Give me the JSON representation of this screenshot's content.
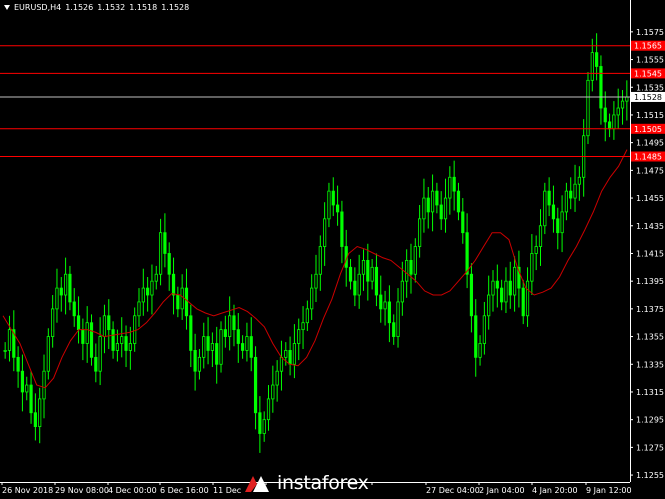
{
  "window": {
    "symbol": "EURUSD,H4",
    "ohlc": [
      "1.1526",
      "1.1532",
      "1.1518",
      "1.1528"
    ]
  },
  "watermark": {
    "text": "instaforex"
  },
  "colors": {
    "background": "#000000",
    "candle": "#00ff00",
    "moving_average": "#cc0000",
    "level_line": "#ff0000",
    "level_label_bg": "#ff0000",
    "current_price_line": "#c0c0c0",
    "axis_text": "#ffffff"
  },
  "chart_data": {
    "type": "candlestick",
    "ylim": [
      1.125,
      1.1585
    ],
    "y_ticks": [
      "1.1575",
      "1.1555",
      "1.1535",
      "1.1515",
      "1.1495",
      "1.1475",
      "1.1455",
      "1.1435",
      "1.1415",
      "1.1395",
      "1.1375",
      "1.1355",
      "1.1335",
      "1.1315",
      "1.1295",
      "1.1275",
      "1.1255"
    ],
    "x_tick_labels": [
      "26 Nov 2018",
      "29 Nov 08:00",
      "4 Dec 00:00",
      "6 Dec 16:00",
      "11 Dec",
      "",
      "",
      "",
      "27 Dec 04:00",
      "2 Jan 04:00",
      "4 Jan 20:00",
      "9 Jan 12:00"
    ],
    "level_lines": [
      {
        "value": 1.1565,
        "label": "1.1565"
      },
      {
        "value": 1.1545,
        "label": "1.1545"
      },
      {
        "value": 1.1505,
        "label": "1.1505"
      },
      {
        "value": 1.1485,
        "label": "1.1485"
      }
    ],
    "current_price": {
      "value": 1.1528,
      "label": "1.1528"
    },
    "close_path": [
      1.1345,
      1.136,
      1.134,
      1.133,
      1.1315,
      1.132,
      1.13,
      1.129,
      1.131,
      1.133,
      1.1355,
      1.1375,
      1.139,
      1.1385,
      1.14,
      1.138,
      1.137,
      1.136,
      1.135,
      1.1365,
      1.134,
      1.133,
      1.1355,
      1.137,
      1.136,
      1.1345,
      1.135,
      1.1355,
      1.1345,
      1.135,
      1.137,
      1.138,
      1.139,
      1.1385,
      1.1395,
      1.14,
      1.143,
      1.1415,
      1.14,
      1.1385,
      1.1375,
      1.139,
      1.137,
      1.1345,
      1.133,
      1.134,
      1.1355,
      1.1345,
      1.135,
      1.1335,
      1.136,
      1.1355,
      1.137,
      1.136,
      1.135,
      1.1345,
      1.1355,
      1.134,
      1.13,
      1.1285,
      1.1295,
      1.131,
      1.132,
      1.133,
      1.134,
      1.1345,
      1.1335,
      1.135,
      1.136,
      1.1365,
      1.1375,
      1.139,
      1.14,
      1.142,
      1.144,
      1.146,
      1.145,
      1.1445,
      1.142,
      1.1405,
      1.1395,
      1.1385,
      1.14,
      1.141,
      1.1395,
      1.1405,
      1.1385,
      1.1375,
      1.138,
      1.1365,
      1.1355,
      1.138,
      1.1395,
      1.141,
      1.14,
      1.142,
      1.144,
      1.1455,
      1.1445,
      1.146,
      1.145,
      1.144,
      1.1455,
      1.147,
      1.146,
      1.1445,
      1.143,
      1.14,
      1.137,
      1.134,
      1.135,
      1.137,
      1.1385,
      1.1395,
      1.139,
      1.138,
      1.1395,
      1.1385,
      1.1405,
      1.139,
      1.137,
      1.1395,
      1.1415,
      1.142,
      1.1435,
      1.146,
      1.145,
      1.144,
      1.143,
      1.1445,
      1.146,
      1.1455,
      1.1465,
      1.147,
      1.15,
      1.154,
      1.156,
      1.155,
      1.152,
      1.151,
      1.1505,
      1.1515,
      1.152,
      1.1525,
      1.1528
    ],
    "ma_path": [
      1.137,
      1.136,
      1.135,
      1.1335,
      1.132,
      1.1318,
      1.1325,
      1.134,
      1.1352,
      1.136,
      1.136,
      1.1358,
      1.1355,
      1.1356,
      1.1357,
      1.1358,
      1.136,
      1.1365,
      1.1372,
      1.138,
      1.1386,
      1.1385,
      1.138,
      1.1375,
      1.1372,
      1.137,
      1.1372,
      1.1374,
      1.1376,
      1.1373,
      1.1368,
      1.1362,
      1.135,
      1.134,
      1.1335,
      1.1334,
      1.134,
      1.1352,
      1.1368,
      1.1382,
      1.14,
      1.1415,
      1.142,
      1.1418,
      1.1415,
      1.1412,
      1.141,
      1.1405,
      1.14,
      1.1395,
      1.1388,
      1.1385,
      1.1385,
      1.1388,
      1.1395,
      1.1402,
      1.141,
      1.142,
      1.143,
      1.143,
      1.1425,
      1.1405,
      1.139,
      1.1385,
      1.1387,
      1.139,
      1.1398,
      1.141,
      1.142,
      1.1432,
      1.1445,
      1.146,
      1.147,
      1.1478,
      1.149
    ]
  }
}
